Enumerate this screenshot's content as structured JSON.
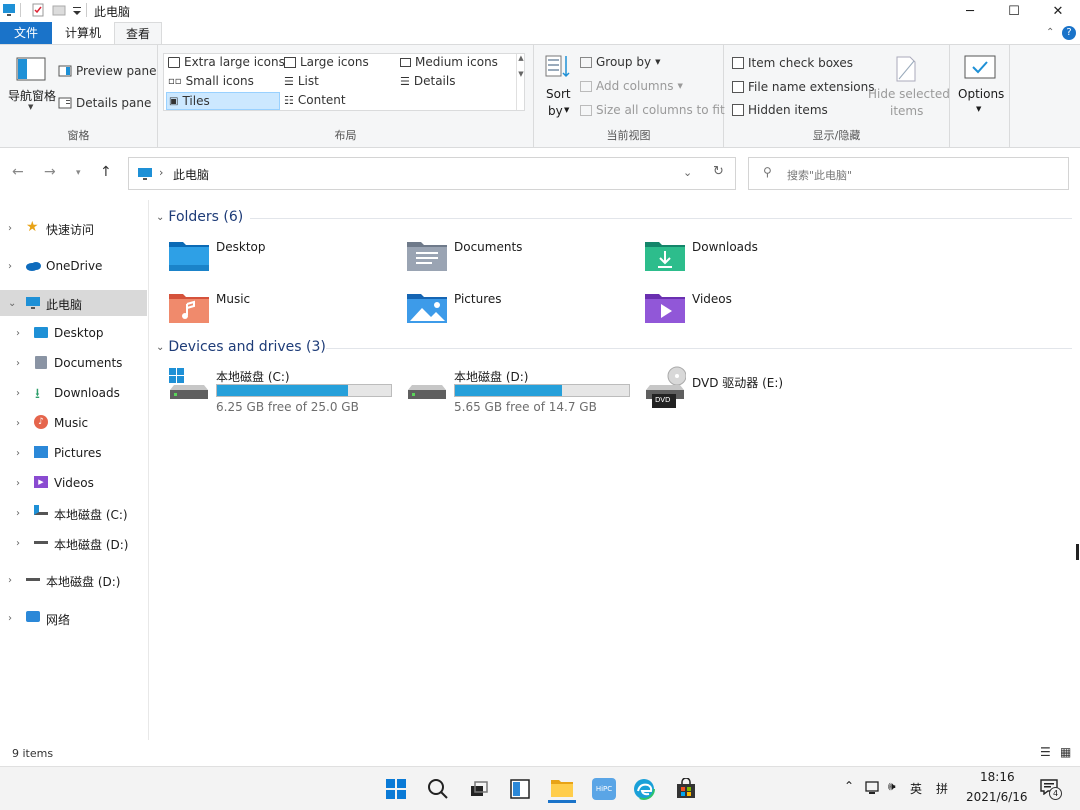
{
  "window": {
    "title": "此电脑",
    "controls": {
      "minimize": "─",
      "maximize": "☐",
      "close": "✕"
    }
  },
  "ribbon_tabs": [
    "文件",
    "计算机",
    "查看"
  ],
  "ribbon": {
    "panes": {
      "label": "窗格",
      "nav_pane": "导航窗格",
      "preview_pane": "Preview pane",
      "details_pane": "Details pane"
    },
    "layout": {
      "label": "布局",
      "options": [
        "Extra large icons",
        "Large icons",
        "Medium icons",
        "Small icons",
        "List",
        "Details",
        "Tiles",
        "Content"
      ],
      "selected": "Tiles"
    },
    "current_view": {
      "label": "当前视图",
      "sort_by_1": "Sort",
      "sort_by_2": "by",
      "group_by": "Group by",
      "add_columns": "Add columns",
      "size_all_columns": "Size all columns to fit"
    },
    "show_hide": {
      "label": "显示/隐藏",
      "item_check_boxes": "Item check boxes",
      "file_name_extensions": "File name extensions",
      "hidden_items": "Hidden items",
      "hide_selected_1": "Hide selected",
      "hide_selected_2": "items"
    },
    "options": {
      "label": "Options"
    }
  },
  "address": {
    "path": "此电脑",
    "separator": "›",
    "search_placeholder": "搜索\"此电脑\""
  },
  "nav_pane": {
    "items": [
      {
        "label": "快速访问",
        "icon": "star-icon"
      },
      {
        "label": "OneDrive",
        "icon": "cloud-icon"
      },
      {
        "label": "此电脑",
        "icon": "computer-icon",
        "selected": true
      },
      {
        "label": "Desktop",
        "icon": "desktop-folder-icon"
      },
      {
        "label": "Documents",
        "icon": "documents-folder-icon"
      },
      {
        "label": "Downloads",
        "icon": "download-icon"
      },
      {
        "label": "Music",
        "icon": "music-icon"
      },
      {
        "label": "Pictures",
        "icon": "pictures-icon"
      },
      {
        "label": "Videos",
        "icon": "videos-icon"
      },
      {
        "label": "本地磁盘 (C:)",
        "icon": "drive-icon"
      },
      {
        "label": "本地磁盘 (D:)",
        "icon": "drive-icon"
      },
      {
        "label": "本地磁盘 (D:)",
        "icon": "drive-icon"
      },
      {
        "label": "网络",
        "icon": "network-icon"
      }
    ]
  },
  "content": {
    "folders_header": "Folders (6)",
    "folders": [
      {
        "label": "Desktop",
        "icon": "desktop-folder-icon"
      },
      {
        "label": "Documents",
        "icon": "documents-folder-icon"
      },
      {
        "label": "Downloads",
        "icon": "downloads-folder-icon"
      },
      {
        "label": "Music",
        "icon": "music-folder-icon"
      },
      {
        "label": "Pictures",
        "icon": "pictures-folder-icon"
      },
      {
        "label": "Videos",
        "icon": "videos-folder-icon"
      }
    ],
    "drives_header": "Devices and drives (3)",
    "drives": [
      {
        "label": "本地磁盘 (C:)",
        "free": "6.25 GB free of 25.0 GB",
        "used_fraction": 0.75
      },
      {
        "label": "本地磁盘 (D:)",
        "free": "5.65 GB free of 14.7 GB",
        "used_fraction": 0.616
      },
      {
        "label": "DVD 驱动器 (E:)",
        "badge": "DVD"
      }
    ]
  },
  "status": {
    "items": "9 items"
  },
  "taskbar": {
    "time": "18:16",
    "date": "2021/6/16",
    "ime_lang": "英",
    "ime_mode": "拼",
    "notifications": "4",
    "hipc_label": "HiPC"
  },
  "colors": {
    "accent": "#1a73c9",
    "drive_bar": "#26a0da",
    "section_header": "#1e3c78"
  }
}
